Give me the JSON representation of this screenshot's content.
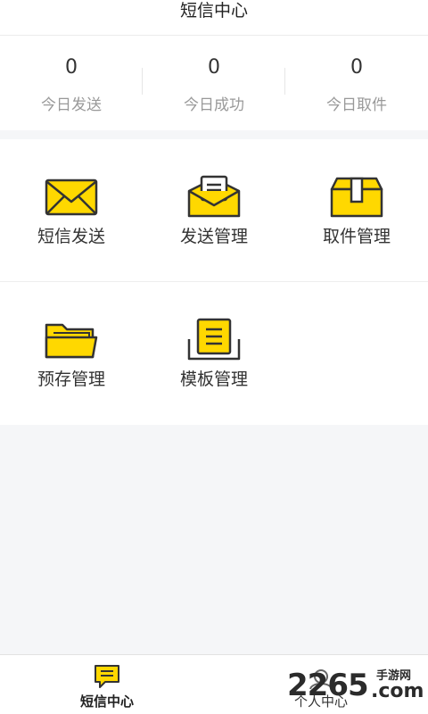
{
  "header": {
    "title": "短信中心"
  },
  "stats": [
    {
      "value": "0",
      "label": "今日发送"
    },
    {
      "value": "0",
      "label": "今日成功"
    },
    {
      "value": "0",
      "label": "今日取件"
    }
  ],
  "grid": {
    "row1": [
      {
        "label": "短信发送",
        "icon": "envelope-icon"
      },
      {
        "label": "发送管理",
        "icon": "open-envelope-icon"
      },
      {
        "label": "取件管理",
        "icon": "package-icon"
      }
    ],
    "row2": [
      {
        "label": "预存管理",
        "icon": "folder-icon"
      },
      {
        "label": "模板管理",
        "icon": "document-tray-icon"
      }
    ]
  },
  "tabbar": {
    "tabs": [
      {
        "label": "短信中心",
        "icon": "message-icon",
        "active": true
      },
      {
        "label": "个人中心",
        "icon": "person-icon",
        "active": false
      }
    ]
  },
  "watermark": {
    "digits": "2265",
    "com": ".com",
    "cn": "手游网"
  },
  "colors": {
    "accent": "#FFD800",
    "outline": "#333333",
    "background": "#F5F6F8"
  }
}
